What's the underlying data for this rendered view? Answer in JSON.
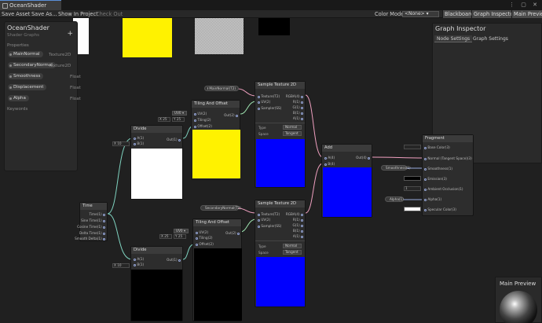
{
  "window": {
    "tab_title": "OceanShader"
  },
  "toolbar": {
    "save_asset": "Save Asset",
    "save_as": "Save As...",
    "show_in_project": "Show In Project",
    "check_out": "Check Out",
    "color_mode_label": "Color Mode",
    "color_mode_value": "<None>",
    "blackboard": "Blackboard",
    "graph_inspector": "Graph Inspector",
    "main_preview": "Main Preview"
  },
  "blackboard": {
    "title": "OceanShader",
    "subtitle": "Shader Graphs",
    "add": "+",
    "properties_label": "Properties",
    "keywords_label": "Keywords",
    "properties": [
      {
        "name": "MainNormal",
        "type": "Texture2D"
      },
      {
        "name": "SecondaryNormal",
        "type": "Texture2D"
      },
      {
        "name": "Smoothness",
        "type": "Float"
      },
      {
        "name": "Displacement",
        "type": "Float"
      },
      {
        "name": "Alpha",
        "type": "Float"
      }
    ]
  },
  "inspector": {
    "title": "Graph Inspector",
    "tabs": [
      "Node Settings",
      "Graph Settings"
    ]
  },
  "main_preview": {
    "title": "Main Preview"
  },
  "nodes": {
    "divide_top": {
      "title": "Divide",
      "ports_in": [
        "A(1)",
        "B(1)"
      ],
      "port_out": "Out(1)",
      "b_value": "X  10"
    },
    "divide_bottom": {
      "title": "Divide",
      "ports_in": [
        "A(1)",
        "B(1)"
      ],
      "port_out": "Out(1)",
      "b_value": "X  10"
    },
    "tiling_top": {
      "title": "Tiling And Offset",
      "ports_in": [
        "UV(2)",
        "Tiling(2)",
        "Offset(2)"
      ],
      "port_out": "Out(2)",
      "uv_sel": "UV0",
      "tiling_vals": [
        "X  25",
        "Y  25"
      ]
    },
    "tiling_bottom": {
      "title": "Tiling And Offset",
      "ports_in": [
        "UV(2)",
        "Tiling(2)",
        "Offset(2)"
      ],
      "port_out": "Out(2)",
      "uv_sel": "UV0",
      "tiling_vals": [
        "X  25",
        "Y  25"
      ]
    },
    "sample_top": {
      "title": "Sample Texture 2D",
      "ports_in": [
        "Texture(T2)",
        "UV(2)",
        "Sampler(SS)"
      ],
      "ports_out": [
        "RGBA(4)",
        "R(1)",
        "G(1)",
        "B(1)",
        "A(1)"
      ],
      "type_label": "Type",
      "type_value": "Normal",
      "space_label": "Space",
      "space_value": "Tangent",
      "prop_pill": "MainNormal(T2)"
    },
    "sample_bottom": {
      "title": "Sample Texture 2D",
      "ports_in": [
        "Texture(T2)",
        "UV(2)",
        "Sampler(SS)"
      ],
      "ports_out": [
        "RGBA(4)",
        "R(1)",
        "G(1)",
        "B(1)",
        "A(1)"
      ],
      "type_label": "Type",
      "type_value": "Normal",
      "space_label": "Space",
      "space_value": "Tangent",
      "prop_pill": "SecondaryNormal(T2)"
    },
    "add": {
      "title": "Add",
      "ports_in": [
        "A(4)",
        "B(4)"
      ],
      "port_out": "Out(4)"
    },
    "time": {
      "title": "Time",
      "ports_out": [
        "Time(1)",
        "Sine Time(1)",
        "Cosine Time(1)",
        "Delta Time(1)",
        "Smooth Delta(1)"
      ]
    },
    "fragment": {
      "title": "Fragment",
      "ports": [
        "Base Color(3)",
        "Normal (Tangent Space)(3)",
        "Smoothness(1)",
        "Emission(3)",
        "Ambient Occlusion(1)",
        "Alpha(1)",
        "Specular Color(3)"
      ],
      "smoothness_pill": "Smoothness(1)",
      "alpha_pill": "Alpha(1)",
      "ao_value": "1"
    }
  },
  "colors": {
    "accent_blue": "#5a8fd8",
    "preview_yellow": "#fff200",
    "preview_blue": "#0000ff",
    "wire_teal": "#7fd3c0",
    "wire_pink": "#f0a0c0"
  }
}
